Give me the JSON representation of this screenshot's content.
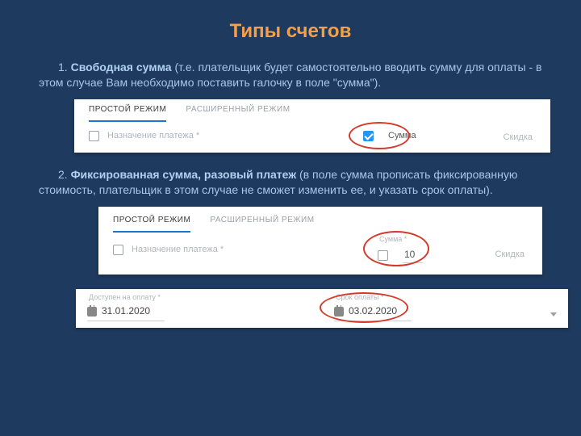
{
  "title": "Типы счетов",
  "section1": {
    "num": "1. ",
    "heading": "Свободная сумма",
    "rest": " (т.е. плательщик будет самостоятельно вводить сумму для оплаты - в этом случае Вам необходимо поставить галочку в поле \"сумма\")."
  },
  "section2": {
    "num": "2. ",
    "heading": "Фиксированная сумма, разовый платеж",
    "rest": " (в поле сумма прописать фиксированную стоимость, плательщик в этом случае не сможет изменить ее, и указать срок оплаты)."
  },
  "panel_common": {
    "tab_simple": "ПРОСТОЙ РЕЖИМ",
    "tab_extended": "РАСШИРЕННЫЙ РЕЖИМ",
    "purpose_label": "Назначение платежа *",
    "amount_label": "Сумма",
    "amount_label_req": "Сумма *",
    "discount_label": "Скидка"
  },
  "panel2_value": "10",
  "panel3": {
    "available_label": "Доступен на оплату *",
    "available_value": "31.01.2020",
    "due_label": "Срок оплаты *",
    "due_value": "03.02.2020"
  }
}
